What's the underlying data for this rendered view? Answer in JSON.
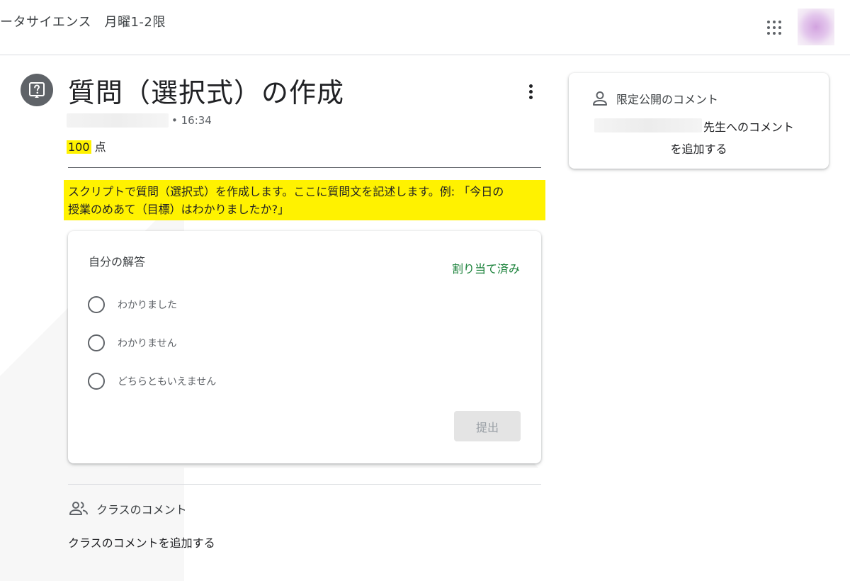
{
  "header": {
    "course_title": "ータサイエンス　月曜1-2限"
  },
  "assignment": {
    "title": "質問（選択式）の作成",
    "time": "• 16:34",
    "points_value": "100",
    "points_unit": " 点",
    "instructions_line1": "スクリプトで質問（選択式）を作成します。ここに質問文を記述します。例: 「今日の",
    "instructions_line2": "授業のめあて（目標）はわかりましたか?」"
  },
  "answer_card": {
    "title": "自分の解答",
    "status": "割り当て済み",
    "options": [
      {
        "label": "わかりました"
      },
      {
        "label": "わかりません"
      },
      {
        "label": "どちらともいえません"
      }
    ],
    "submit_label": "提出"
  },
  "class_comments": {
    "header": "クラスのコメント",
    "add_label": "クラスのコメントを追加する"
  },
  "private_comments": {
    "header": "限定公開のコメント",
    "add_line1": "先生へのコメント",
    "add_line2": "を追加する"
  },
  "colors": {
    "highlight": "#fff200",
    "status_green": "#188038",
    "icon_grey": "#5f6368"
  },
  "icons": {
    "question": "question-mark-icon",
    "apps": "apps-grid-icon",
    "more": "more-vert-icon",
    "person": "person-icon",
    "people": "people-icon"
  }
}
